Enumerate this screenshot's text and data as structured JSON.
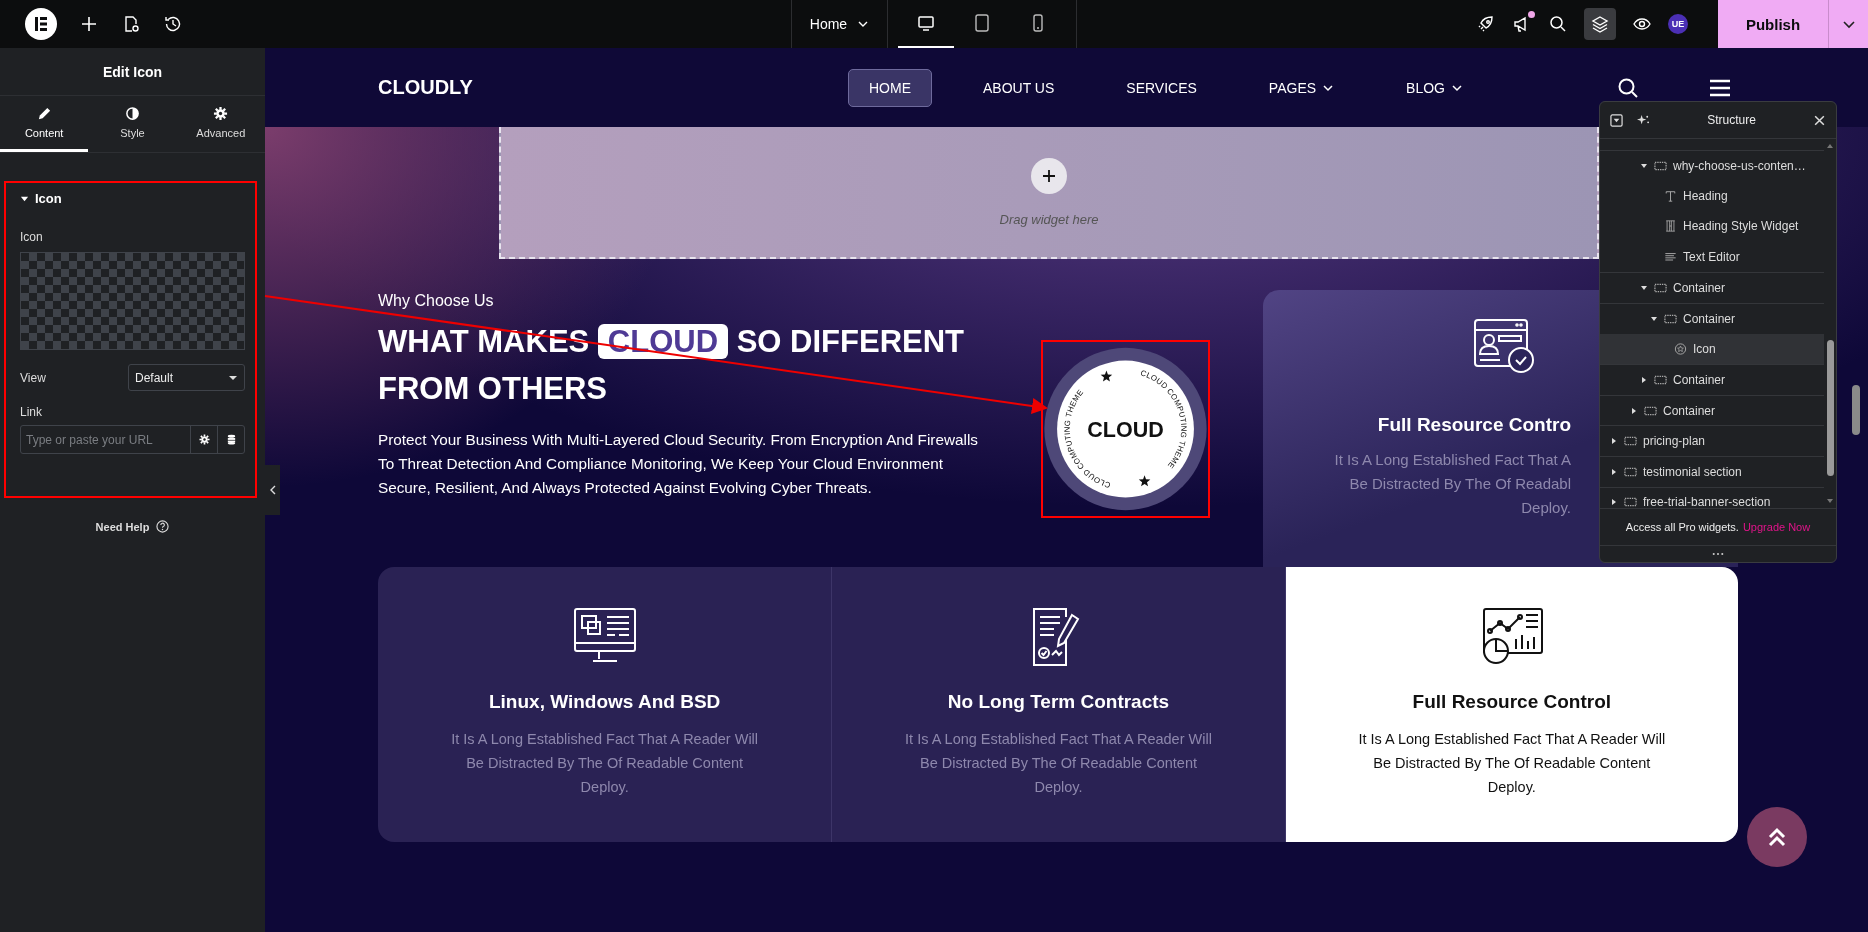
{
  "top_bar": {
    "page_name": "Home",
    "devices": [
      {
        "kind": "desktop",
        "selected": true
      },
      {
        "kind": "tablet",
        "selected": false
      },
      {
        "kind": "mobile",
        "selected": false
      }
    ],
    "structure_active": true,
    "has_notification": true,
    "avatar": "UE",
    "publish": "Publish"
  },
  "panel": {
    "title": "Edit Icon",
    "tabs": [
      {
        "label": "Content",
        "kind": "content",
        "selected": true
      },
      {
        "label": "Style",
        "kind": "style",
        "selected": false
      },
      {
        "label": "Advanced",
        "kind": "advanced",
        "selected": false
      }
    ],
    "section": {
      "title": "Icon",
      "expanded": true,
      "icon_label": "Icon",
      "view_label": "View",
      "view_value": "Default",
      "link_label": "Link",
      "link_placeholder": "Type or paste your URL"
    },
    "help": "Need Help"
  },
  "site": {
    "logo": "CLOUDLY",
    "menu": [
      {
        "label": "HOME",
        "selected": true,
        "dropdown": false
      },
      {
        "label": "ABOUT US",
        "selected": false,
        "dropdown": false
      },
      {
        "label": "SERVICES",
        "selected": false,
        "dropdown": false
      },
      {
        "label": "PAGES",
        "selected": false,
        "dropdown": true
      },
      {
        "label": "BLOG",
        "selected": false,
        "dropdown": true
      }
    ],
    "drop_hint": "Drag widget here",
    "eyebrow": "Why Choose Us",
    "heading_before": "WHAT MAKES",
    "heading_highlight": "CLOUD",
    "heading_after": "SO DIFFERENT",
    "heading_line2": "FROM OTHERS",
    "body_lines": [
      "Protect Your Business With Multi-Layered Cloud Security. From Encryption And Firewalls",
      "To Threat Detection And Compliance Monitoring, We Keep Your Cloud Environment",
      "Secure, Resilient, And Always Protected Against Evolving Cyber Threats."
    ],
    "badge": {
      "center": "CLOUD",
      "ring": [
        "CLOUD COMPUTING THEME",
        "CLOUD COMPUTING THEME"
      ]
    },
    "side_card": {
      "title": "Full Resource Contro",
      "text_lines": [
        "It Is A Long Established Fact That A",
        "Be Distracted By The Of Readabl",
        "Deploy."
      ]
    },
    "features": [
      {
        "kind": "monitor",
        "title": "Linux, Windows And BSD",
        "text_lines": [
          "It Is A Long Established Fact That A Reader Will",
          "Be Distracted By The Of Readable Content",
          "Deploy."
        ],
        "active": false
      },
      {
        "kind": "contract",
        "title": "No Long Term Contracts",
        "text_lines": [
          "It Is A Long Established Fact That A Reader Will",
          "Be Distracted By The Of Readable Content",
          "Deploy."
        ],
        "active": false
      },
      {
        "kind": "analytics",
        "title": "Full Resource Control",
        "text_lines": [
          "It Is A Long Established Fact That A Reader Will",
          "Be Distracted By The Of Readable Content",
          "Deploy."
        ],
        "active": true
      }
    ]
  },
  "structure": {
    "title": "Structure",
    "tree": [
      {
        "children": [
          {
            "children": [
              {
                "label": "why-choose-us-conten…",
                "kind": "container",
                "expanded": true,
                "selected": false,
                "children": [
                  {
                    "label": "Heading",
                    "kind": "heading",
                    "selected": false
                  },
                  {
                    "label": "Heading Style Widget",
                    "kind": "heading-style",
                    "selected": false
                  },
                  {
                    "label": "Text Editor",
                    "kind": "text-editor",
                    "selected": false
                  }
                ]
              },
              {
                "label": "Container",
                "kind": "container",
                "expanded": true,
                "selected": false,
                "children": [
                  {
                    "label": "Container",
                    "kind": "container",
                    "expanded": true,
                    "selected": false,
                    "children": [
                      {
                        "label": "Icon",
                        "kind": "icon",
                        "selected": true
                      }
                    ]
                  }
                ]
              },
              {
                "label": "Container",
                "kind": "container",
                "expanded": false,
                "selected": false
              }
            ]
          },
          {
            "label": "Container",
            "kind": "container",
            "expanded": false,
            "selected": false
          }
        ]
      },
      {
        "label": "pricing-plan",
        "kind": "container",
        "expanded": false,
        "selected": false
      },
      {
        "label": "testimonial section",
        "kind": "container",
        "expanded": false,
        "selected": false
      },
      {
        "label": "free-trial-banner-section",
        "kind": "container",
        "expanded": false,
        "selected": false
      }
    ],
    "footer_text": "Access all Pro widgets.",
    "footer_link": "Upgrade Now"
  }
}
